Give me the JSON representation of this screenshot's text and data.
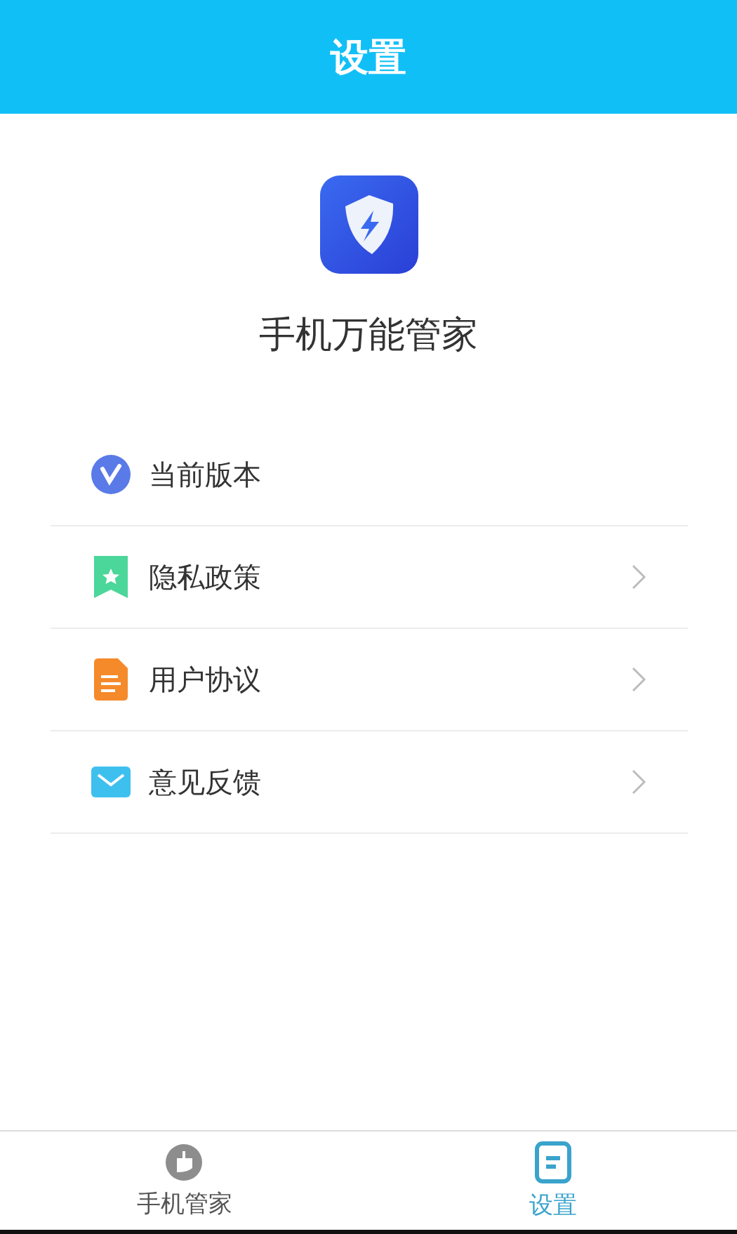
{
  "header": {
    "title": "设置"
  },
  "app": {
    "name": "手机万能管家"
  },
  "menu": [
    {
      "kind": "version",
      "label": "当前版本",
      "chevron": false
    },
    {
      "kind": "privacy",
      "label": "隐私政策",
      "chevron": true
    },
    {
      "kind": "agreement",
      "label": "用户协议",
      "chevron": true
    },
    {
      "kind": "feedback",
      "label": "意见反馈",
      "chevron": true
    }
  ],
  "tabs": [
    {
      "kind": "cleaner",
      "label": "手机管家",
      "selected": false
    },
    {
      "kind": "settings",
      "label": "设置",
      "selected": true
    }
  ]
}
